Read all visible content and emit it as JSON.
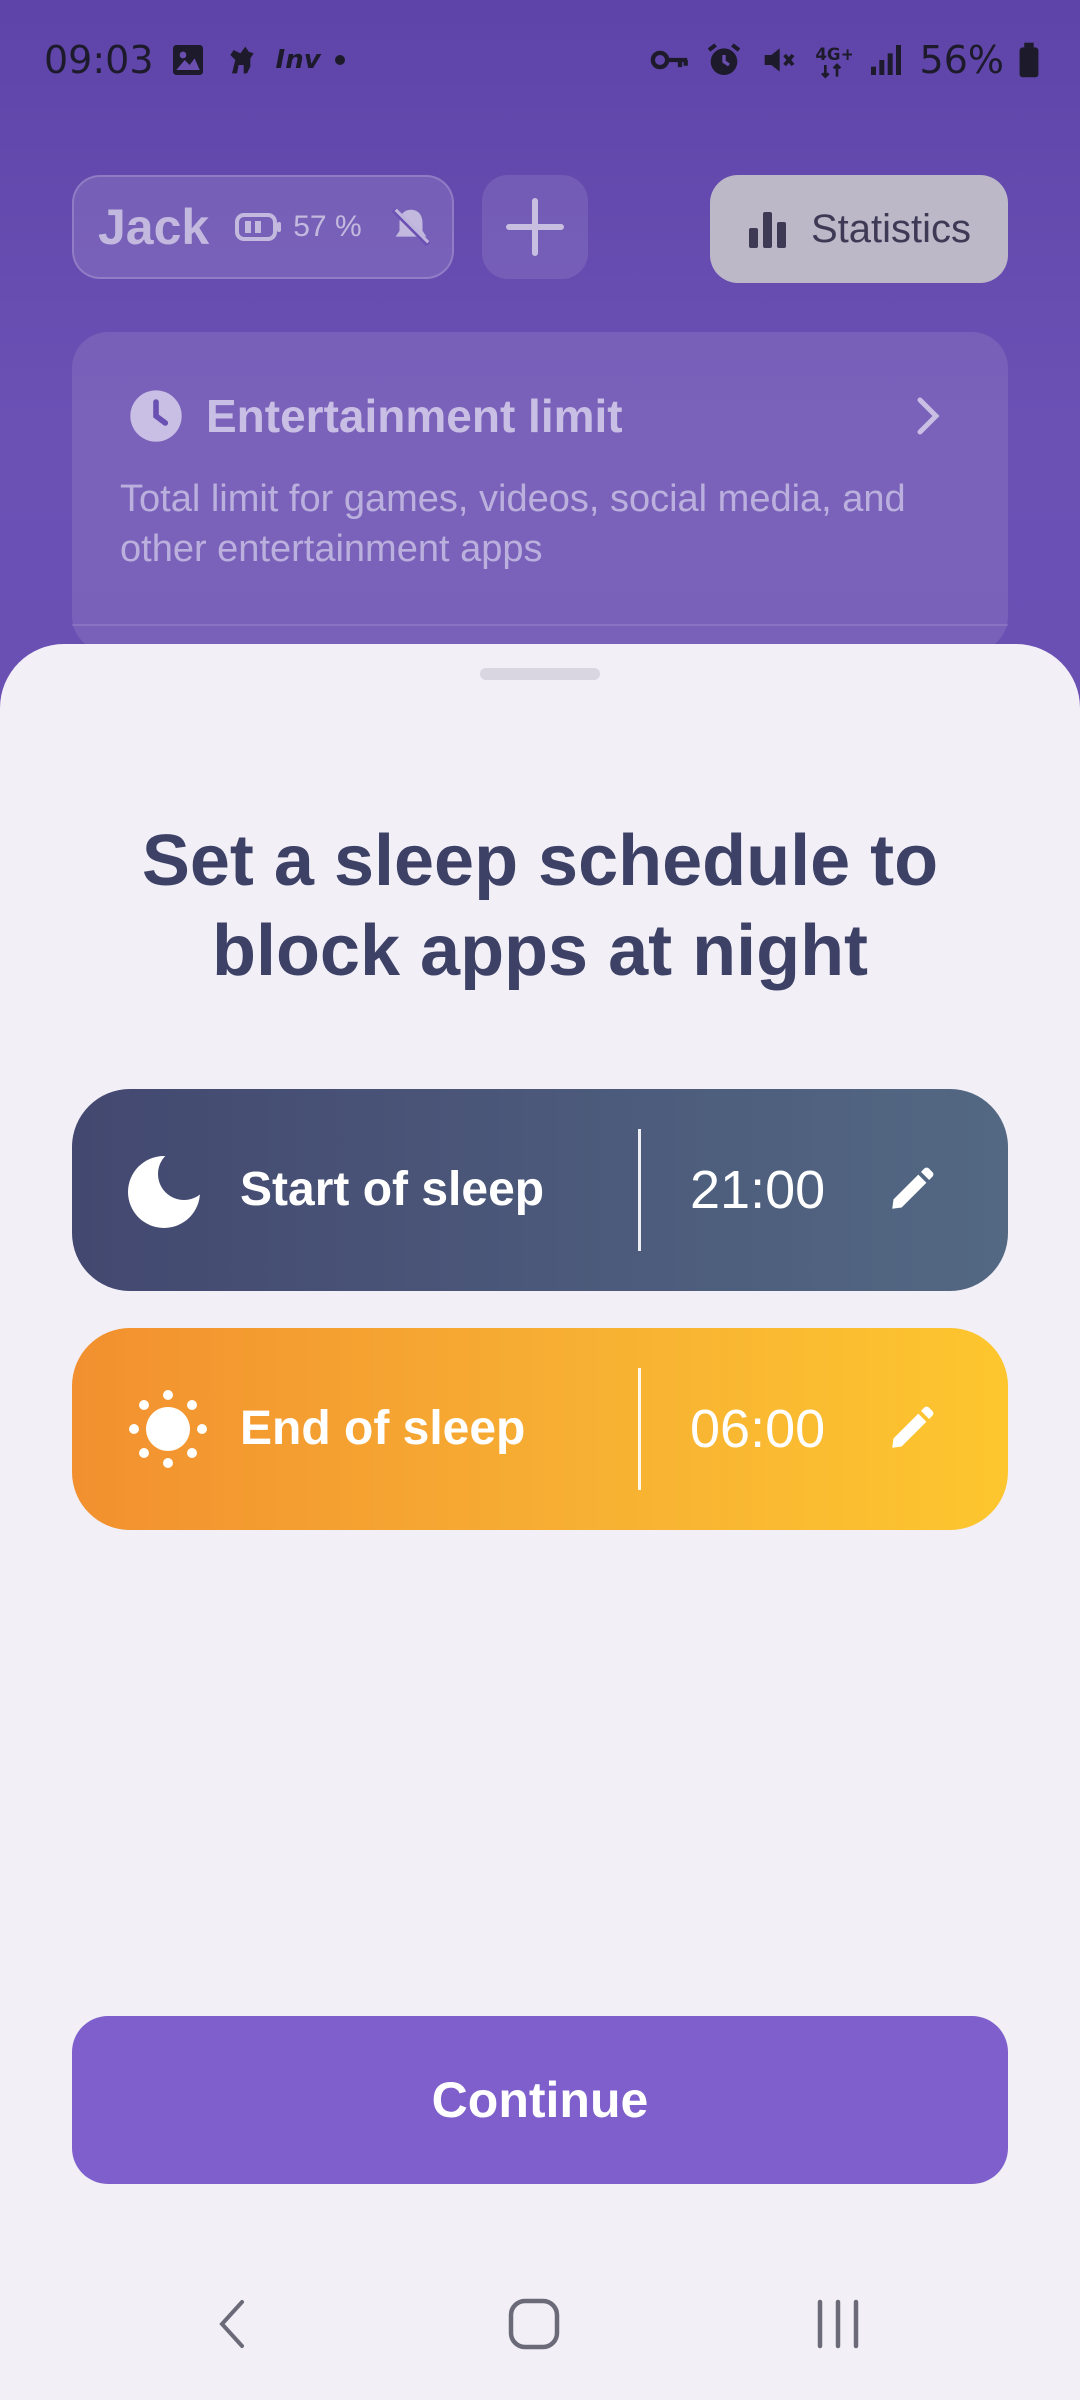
{
  "status_bar": {
    "time": "09:03",
    "notification_label": "Inv",
    "battery_text": "56%",
    "icons_left": [
      "gallery-icon",
      "dog-icon",
      "inv-icon",
      "dot"
    ],
    "icons_right": [
      "vpn-key-icon",
      "alarm-icon",
      "mute-icon",
      "4g-icon",
      "signal-icon",
      "battery-icon"
    ]
  },
  "header": {
    "user_name": "Jack",
    "user_battery": "57 %",
    "stats_label": "Statistics"
  },
  "entertainment_card": {
    "title": "Entertainment limit",
    "description": "Total limit for games, videos, social media, and other entertainment apps"
  },
  "sheet": {
    "title": "Set a sleep schedule to block apps at night",
    "start": {
      "label": "Start of sleep",
      "time": "21:00"
    },
    "end": {
      "label": "End of sleep",
      "time": "06:00"
    },
    "continue_label": "Continue"
  },
  "colors": {
    "brand_purple": "#7f5fcb",
    "night_start": "#434870",
    "night_end": "#536883",
    "day_start": "#f2902f",
    "day_end": "#fdc62e",
    "title_text": "#3d4166",
    "sheet_bg": "#f2eff7"
  }
}
